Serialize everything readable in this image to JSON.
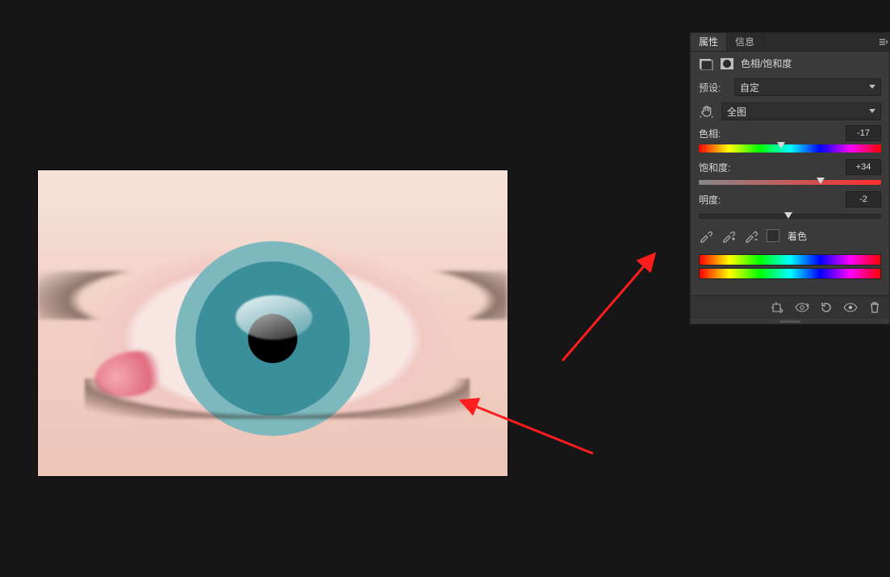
{
  "panel": {
    "tabs": {
      "properties": "属性",
      "info": "信息"
    },
    "adjustment_title": "色相/饱和度",
    "preset": {
      "label": "预设:",
      "value": "自定"
    },
    "channel": {
      "value": "全图"
    },
    "hue": {
      "label": "色相:",
      "value": "-17",
      "pos_pct": 45
    },
    "saturation": {
      "label": "饱和度:",
      "value": "+34",
      "pos_pct": 67
    },
    "lightness": {
      "label": "明度:",
      "value": "-2",
      "pos_pct": 49
    },
    "colorize_label": "着色"
  }
}
